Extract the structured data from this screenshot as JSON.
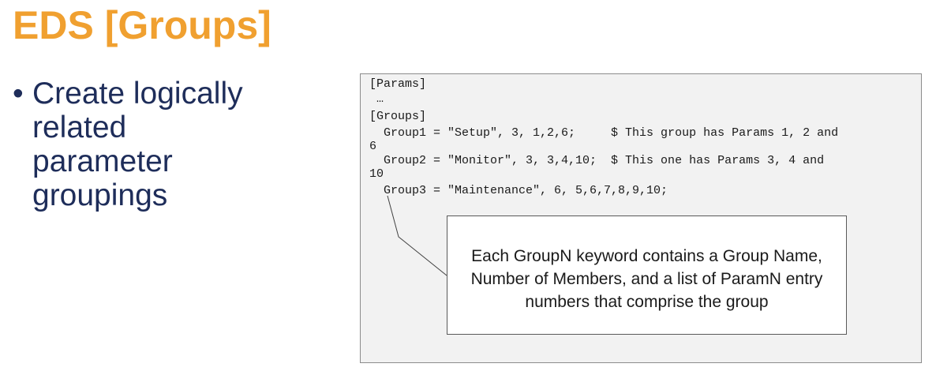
{
  "title": "EDS [Groups]",
  "bullets": [
    {
      "text": "Create logically related parameter groupings"
    }
  ],
  "code_lines": [
    "[Params]",
    " …",
    "[Groups]",
    "  Group1 = \"Setup\", 3, 1,2,6;     $ This group has Params 1, 2 and",
    "6",
    "  Group2 = \"Monitor\", 3, 3,4,10;  $ This one has Params 3, 4 and",
    "10",
    "  Group3 = \"Maintenance\", 6, 5,6,7,8,9,10;"
  ],
  "callout": {
    "text": "Each GroupN keyword contains a Group Name, Number of Members, and a list of ParamN entry numbers that comprise the group"
  }
}
